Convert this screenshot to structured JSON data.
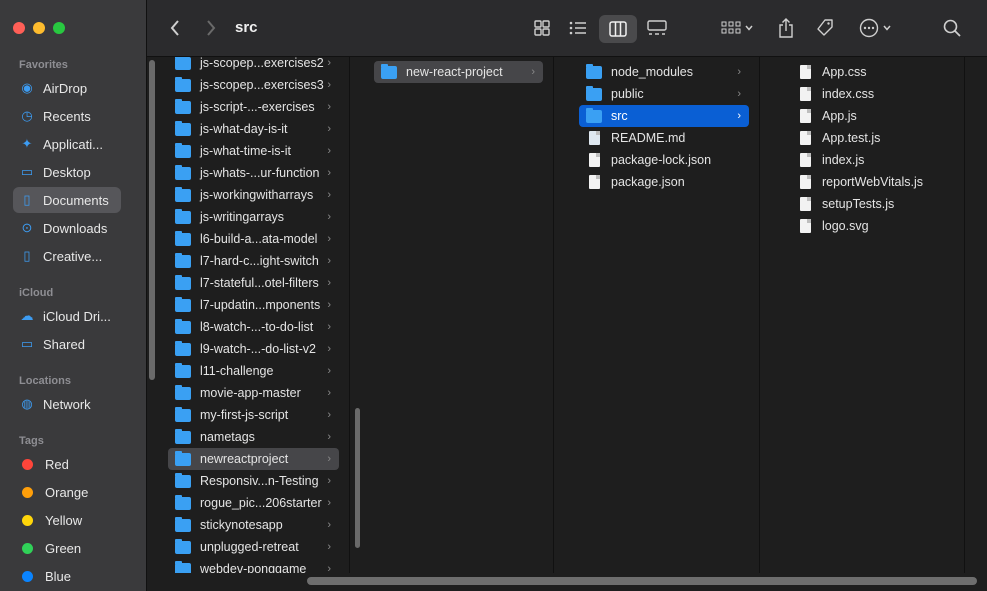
{
  "window": {
    "title": "src"
  },
  "sidebar": {
    "sections": [
      {
        "title": "Favorites",
        "items": [
          {
            "label": "AirDrop",
            "icon": "airdrop-icon",
            "glyph": "◉"
          },
          {
            "label": "Recents",
            "icon": "clock-icon",
            "glyph": "◷"
          },
          {
            "label": "Applicati...",
            "icon": "applications-icon",
            "glyph": "✦"
          },
          {
            "label": "Desktop",
            "icon": "desktop-icon",
            "glyph": "▭"
          },
          {
            "label": "Documents",
            "icon": "document-icon",
            "glyph": "▯",
            "selected": true
          },
          {
            "label": "Downloads",
            "icon": "download-icon",
            "glyph": "⊙"
          },
          {
            "label": "Creative...",
            "icon": "folder-icon",
            "glyph": "▯"
          }
        ]
      },
      {
        "title": "iCloud",
        "items": [
          {
            "label": "iCloud Dri...",
            "icon": "cloud-icon",
            "glyph": "☁"
          },
          {
            "label": "Shared",
            "icon": "shared-folder-icon",
            "glyph": "▭"
          }
        ]
      },
      {
        "title": "Locations",
        "items": [
          {
            "label": "Network",
            "icon": "network-icon",
            "glyph": "◍"
          }
        ]
      },
      {
        "title": "Tags",
        "tags": [
          {
            "label": "Red",
            "color": "#ff453a"
          },
          {
            "label": "Orange",
            "color": "#ff9f0a"
          },
          {
            "label": "Yellow",
            "color": "#ffd60a"
          },
          {
            "label": "Green",
            "color": "#30d158"
          },
          {
            "label": "Blue",
            "color": "#0a84ff"
          }
        ]
      }
    ]
  },
  "columns": [
    {
      "items": [
        {
          "label": "js-scopep...exercises2",
          "type": "folder"
        },
        {
          "label": "js-scopep...exercises3",
          "type": "folder"
        },
        {
          "label": "js-script-...-exercises",
          "type": "folder"
        },
        {
          "label": "js-what-day-is-it",
          "type": "folder"
        },
        {
          "label": "js-what-time-is-it",
          "type": "folder"
        },
        {
          "label": "js-whats-...ur-function",
          "type": "folder"
        },
        {
          "label": "js-workingwitharrays",
          "type": "folder"
        },
        {
          "label": "js-writingarrays",
          "type": "folder"
        },
        {
          "label": "l6-build-a...ata-model",
          "type": "folder"
        },
        {
          "label": "l7-hard-c...ight-switch",
          "type": "folder"
        },
        {
          "label": "l7-stateful...otel-filters",
          "type": "folder"
        },
        {
          "label": "l7-updatin...mponents",
          "type": "folder"
        },
        {
          "label": "l8-watch-...-to-do-list",
          "type": "folder"
        },
        {
          "label": "l9-watch-...-do-list-v2",
          "type": "folder"
        },
        {
          "label": "l11-challenge",
          "type": "folder"
        },
        {
          "label": "movie-app-master",
          "type": "folder"
        },
        {
          "label": "my-first-js-script",
          "type": "folder"
        },
        {
          "label": "nametags",
          "type": "folder"
        },
        {
          "label": "newreactproject",
          "type": "folder",
          "selected": "gray"
        },
        {
          "label": "Responsiv...n-Testing",
          "type": "folder"
        },
        {
          "label": "rogue_pic...206starter",
          "type": "folder"
        },
        {
          "label": "stickynotesapp",
          "type": "folder"
        },
        {
          "label": "unplugged-retreat",
          "type": "folder"
        },
        {
          "label": "webdev-ponggame",
          "type": "folder"
        }
      ]
    },
    {
      "items": [
        {
          "label": "new-react-project",
          "type": "folder",
          "selected": "gray"
        }
      ]
    },
    {
      "items": [
        {
          "label": "node_modules",
          "type": "folder"
        },
        {
          "label": "public",
          "type": "folder"
        },
        {
          "label": "src",
          "type": "folder",
          "selected": "blue"
        },
        {
          "label": "README.md",
          "type": "md"
        },
        {
          "label": "package-lock.json",
          "type": "doc"
        },
        {
          "label": "package.json",
          "type": "doc"
        }
      ]
    },
    {
      "items": [
        {
          "label": "App.css",
          "type": "doc"
        },
        {
          "label": "index.css",
          "type": "doc"
        },
        {
          "label": "App.js",
          "type": "doc"
        },
        {
          "label": "App.test.js",
          "type": "doc"
        },
        {
          "label": "index.js",
          "type": "doc"
        },
        {
          "label": "reportWebVitals.js",
          "type": "doc"
        },
        {
          "label": "setupTests.js",
          "type": "doc"
        },
        {
          "label": "logo.svg",
          "type": "doc"
        }
      ]
    }
  ]
}
